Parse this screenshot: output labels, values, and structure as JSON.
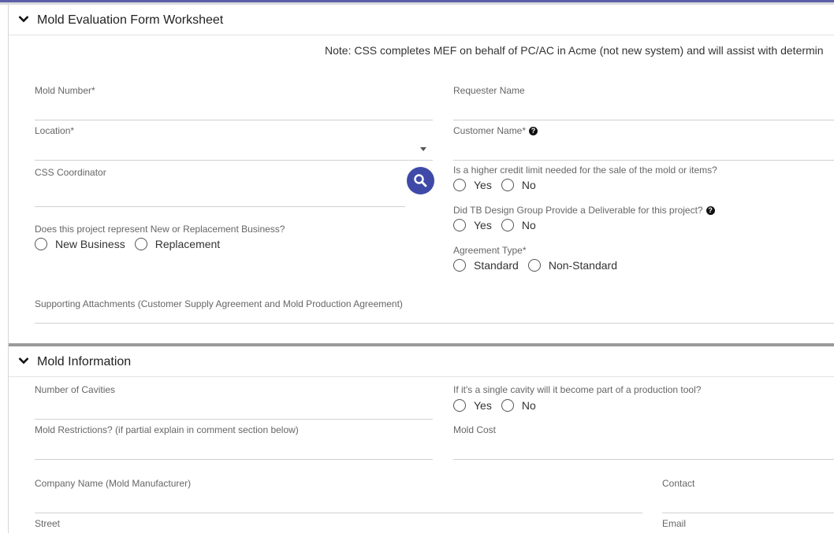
{
  "sections": {
    "mef": {
      "title": "Mold Evaluation Form Worksheet"
    },
    "mold_info": {
      "title": "Mold Information"
    }
  },
  "note": "Note: CSS completes MEF on behalf of PC/AC in Acme (not new system) and will assist with determin",
  "fields": {
    "mold_number": "Mold Number*",
    "requester_name": "Requester Name",
    "location": "Location*",
    "customer_name": "Customer Name*",
    "css_coordinator": "CSS Coordinator",
    "credit_limit": "Is a higher credit limit needed for the sale of the mold or items?",
    "tb_design": "Did TB Design Group Provide a Deliverable for this project?",
    "business_type": "Does this project represent New or Replacement Business?",
    "agreement_type": "Agreement Type*",
    "attachments": "Supporting Attachments (Customer Supply Agreement and Mold Production Agreement)",
    "cavities": "Number of Cavities",
    "single_cavity": "If it's a single cavity will it become part of a production tool?",
    "restrictions": "Mold Restrictions? (if partial explain in comment section below)",
    "mold_cost": "Mold Cost",
    "company_name": "Company Name (Mold Manufacturer)",
    "contact": "Contact",
    "street": "Street",
    "email": "Email"
  },
  "options": {
    "yes": "Yes",
    "no": "No",
    "new_business": "New Business",
    "replacement": "Replacement",
    "standard": "Standard",
    "non_standard": "Non-Standard"
  },
  "icons": {
    "chevron": "chevron-down-icon",
    "help": "help-circle-icon",
    "search": "search-icon"
  },
  "colors": {
    "accent": "#3f4aa8",
    "topbar": "#5b5fa8"
  }
}
